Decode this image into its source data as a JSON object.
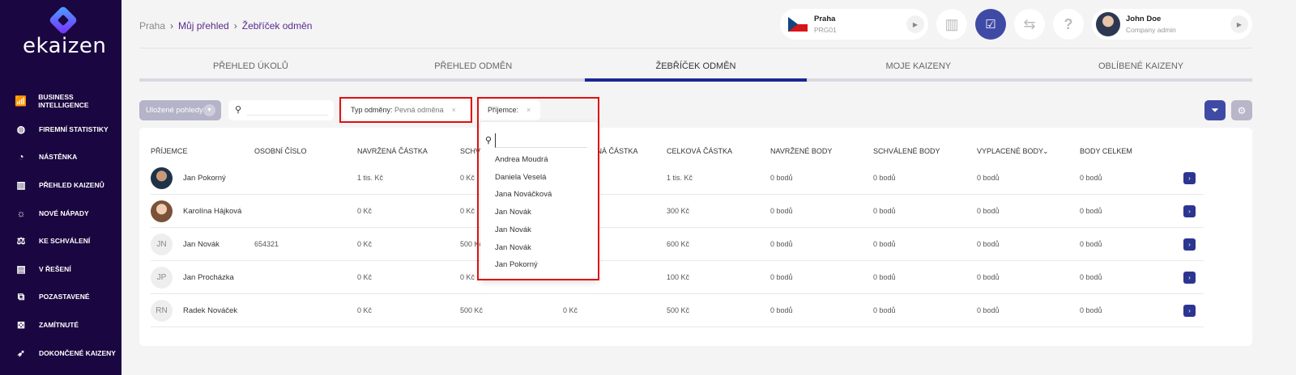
{
  "app": {
    "logo": "ekaizen"
  },
  "sidebar": {
    "items": [
      {
        "label": "BUSINESS INTELLIGENCE",
        "icon": "chart-icon"
      },
      {
        "label": "FIREMNÍ STATISTIKY",
        "icon": "globe-icon"
      },
      {
        "label": "NÁSTĚNKA",
        "icon": "pie-icon"
      },
      {
        "label": "PŘEHLED KAIZENŮ",
        "icon": "columns-icon"
      },
      {
        "label": "NOVÉ NÁPADY",
        "icon": "bulb-icon"
      },
      {
        "label": "KE SCHVÁLENÍ",
        "icon": "scale-icon"
      },
      {
        "label": "V ŘEŠENÍ",
        "icon": "clipboard-icon"
      },
      {
        "label": "POZASTAVENÉ",
        "icon": "pause-icon"
      },
      {
        "label": "ZAMÍTNUTÉ",
        "icon": "reject-icon"
      },
      {
        "label": "DOKONČENÉ KAIZENY",
        "icon": "rocket-icon"
      }
    ]
  },
  "breadcrumb": [
    "Praha",
    "Můj přehled",
    "Žebříček odměn"
  ],
  "header": {
    "location": {
      "name": "Praha",
      "code": "PRG01"
    },
    "user": {
      "name": "John Doe",
      "role": "Company admin"
    },
    "help": "?"
  },
  "tabs": [
    "PŘEHLED ÚKOLŮ",
    "PŘEHLED ODMĚN",
    "ŽEBŘÍČEK ODMĚN",
    "MOJE KAIZENY",
    "OBLÍBENÉ KAIZENY"
  ],
  "toolbar": {
    "saved_views": "Uložené pohledy",
    "filter1_label": "Typ odměny:",
    "filter1_value": "Pevná odměna",
    "filter2_label": "Příjemce:",
    "close": "×"
  },
  "dropdown": {
    "options": [
      "Andrea Moudrá",
      "Daniela Veselá",
      "Jana Nováčková",
      "Jan Novák",
      "Jan Novák",
      "Jan Novák",
      "Jan Pokorný"
    ]
  },
  "table": {
    "headers": [
      "PŘÍJEMCE",
      "OSOBNÍ ČÍSLO",
      "NAVRŽENÁ ČÁSTKA",
      "SCHVÁLENÁ ČÁSTKA",
      "VYPLACENÁ ČÁSTKA",
      "CELKOVÁ ČÁSTKA",
      "NAVRŽENÉ BODY",
      "SCHVÁLENÉ BODY",
      "VYPLACENÉ BODY",
      "BODY CELKEM"
    ],
    "rows": [
      {
        "initials": "",
        "name": "Jan Pokorný",
        "id": "",
        "proposed": "1 tis. Kč",
        "approved": "0 Kč",
        "paid": "",
        "total": "1 tis. Kč",
        "p_pts": "0 bodů",
        "a_pts": "0 bodů",
        "pd_pts": "0 bodů",
        "t_pts": "0 bodů"
      },
      {
        "initials": "",
        "name": "Karolína Hájková",
        "id": "",
        "proposed": "0 Kč",
        "approved": "0 Kč",
        "paid": "",
        "total": "300 Kč",
        "p_pts": "0 bodů",
        "a_pts": "0 bodů",
        "pd_pts": "0 bodů",
        "t_pts": "0 bodů"
      },
      {
        "initials": "JN",
        "name": "Jan Novák",
        "id": "654321",
        "proposed": "0 Kč",
        "approved": "500 Kč",
        "paid": "",
        "total": "600 Kč",
        "p_pts": "0 bodů",
        "a_pts": "0 bodů",
        "pd_pts": "0 bodů",
        "t_pts": "0 bodů"
      },
      {
        "initials": "JP",
        "name": "Jan Procházka",
        "id": "",
        "proposed": "0 Kč",
        "approved": "0 Kč",
        "paid": "",
        "total": "100 Kč",
        "p_pts": "0 bodů",
        "a_pts": "0 bodů",
        "pd_pts": "0 bodů",
        "t_pts": "0 bodů"
      },
      {
        "initials": "RN",
        "name": "Radek Nováček",
        "id": "",
        "proposed": "0 Kč",
        "approved": "500 Kč",
        "paid": "0 Kč",
        "total": "500 Kč",
        "p_pts": "0 bodů",
        "a_pts": "0 bodů",
        "pd_pts": "0 bodů",
        "t_pts": "0 bodů"
      }
    ]
  },
  "colors": {
    "sidebar": "#1a0640",
    "accent": "#3f4aa5",
    "highlight": "#e01010"
  }
}
